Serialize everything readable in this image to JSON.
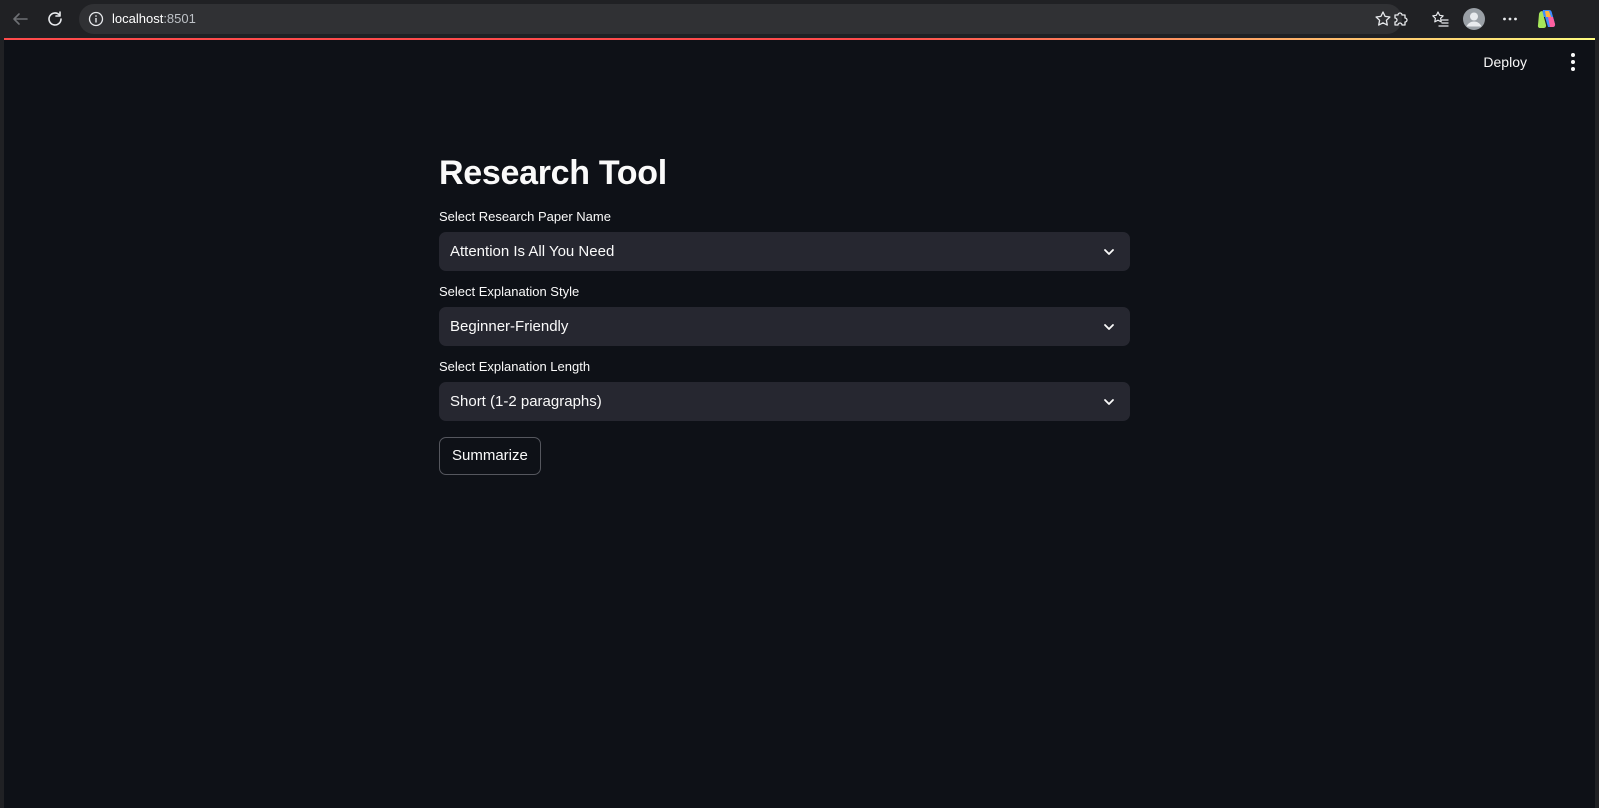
{
  "browser": {
    "url_host": "localhost",
    "url_port": ":8501"
  },
  "header": {
    "deploy_label": "Deploy"
  },
  "main": {
    "title": "Research Tool",
    "fields": [
      {
        "label": "Select Research Paper Name",
        "value": "Attention Is All You Need"
      },
      {
        "label": "Select Explanation Style",
        "value": "Beginner-Friendly"
      },
      {
        "label": "Select Explanation Length",
        "value": "Short (1-2 paragraphs)"
      }
    ],
    "button_label": "Summarize"
  },
  "colors": {
    "app_background": "#0e1117",
    "select_background": "#262730",
    "accent_red": "#ff4b4b"
  }
}
